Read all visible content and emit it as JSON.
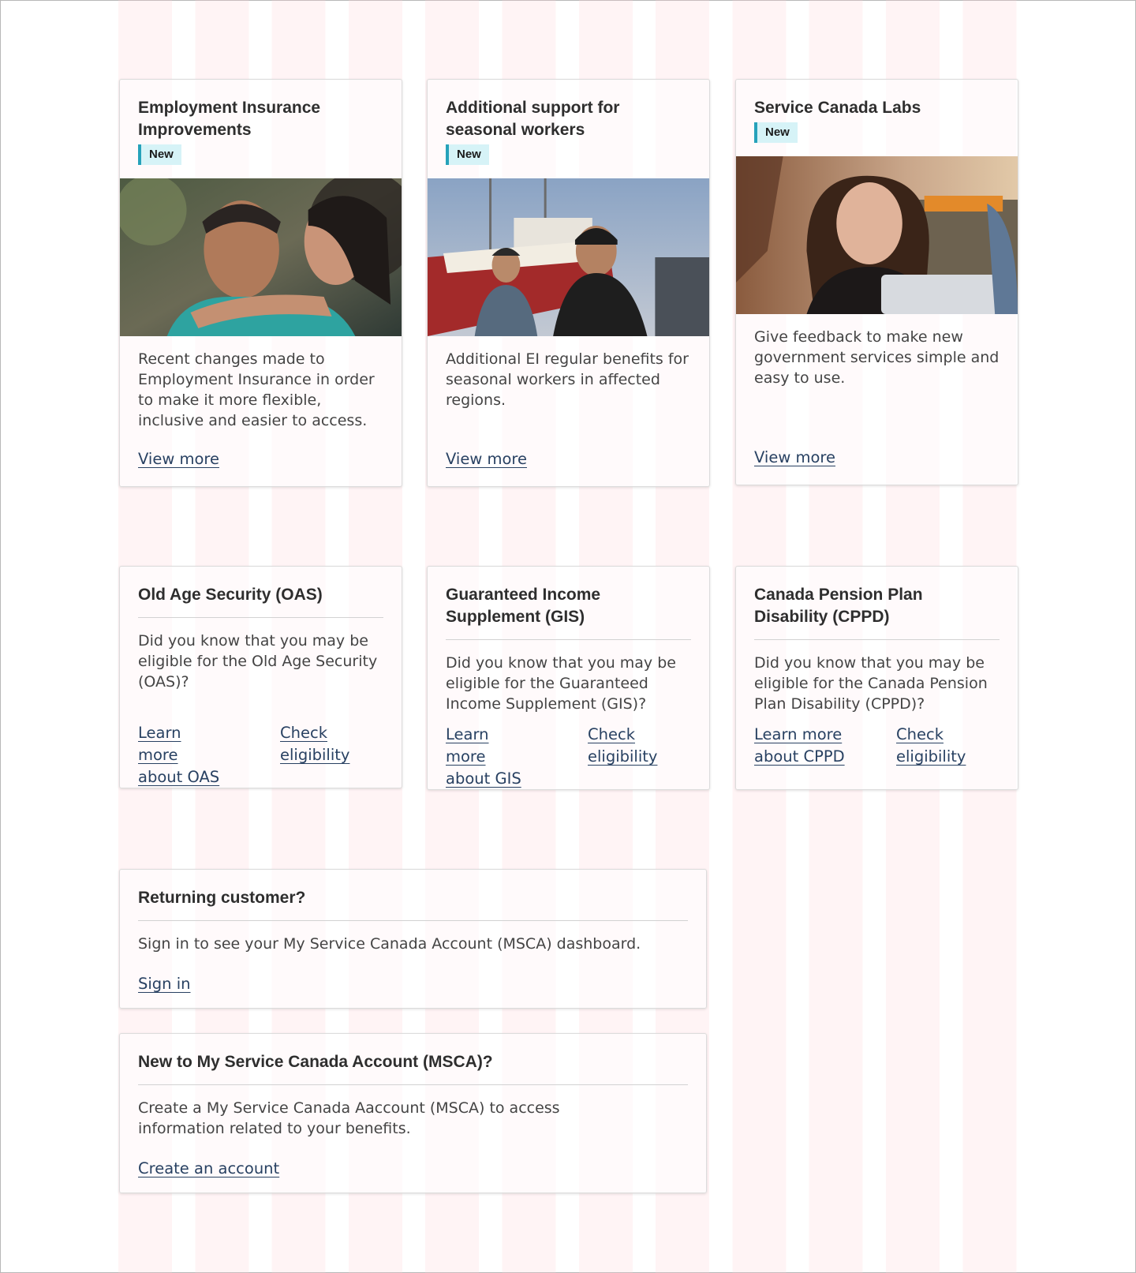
{
  "feature_cards": [
    {
      "title": "Employment Insurance Improvements",
      "badge": "New",
      "image_alt": "photo-two-people-embracing",
      "description": "Recent changes made to Employment Insurance in order to make it more flexible, inclusive and easier to access.",
      "link": "View more"
    },
    {
      "title": "Additional support for seasonal workers",
      "badge": "New",
      "image_alt": "photo-two-fishermen-by-boat",
      "description": "Additional EI regular benefits for seasonal workers in affected regions.",
      "link": "View more"
    },
    {
      "title": "Service Canada Labs",
      "badge": "New",
      "image_alt": "photo-woman-with-laptop",
      "description": "Give feedback to make new government services simple and easy to use.",
      "link": "View more"
    }
  ],
  "benefit_cards": [
    {
      "title": "Old Age Security (OAS)",
      "description": "Did you know that you may be eligible for the Old Age Security (OAS)?",
      "learn_link": "Learn more about OAS",
      "check_link": "Check eligibility"
    },
    {
      "title": "Guaranteed Income Supplement (GIS)",
      "description": "Did you know that you may be eligible for the Guaranteed Income Supplement (GIS)?",
      "learn_link": "Learn more about GIS",
      "check_link": "Check eligibility"
    },
    {
      "title": "Canada Pension Plan Disability (CPPD)",
      "description": "Did you know that you may be eligible for the Canada Pension Plan Disability (CPPD)?",
      "learn_link": "Learn more about CPPD",
      "check_link": "Check eligibility"
    }
  ],
  "account_cards": [
    {
      "title": "Returning customer?",
      "description": "Sign in to see your My Service Canada Account (MSCA) dashboard.",
      "link": "Sign in"
    },
    {
      "title": "New to My Service Canada Account (MSCA)?",
      "description": "Create a My Service Canada Aaccount (MSCA) to access information related to your benefits.",
      "link": "Create an account"
    }
  ],
  "colors": {
    "link": "#284162",
    "badge_bg": "#d6f3f7",
    "badge_border": "#26a2ba",
    "grid_overlay": "#ffcdd2"
  }
}
